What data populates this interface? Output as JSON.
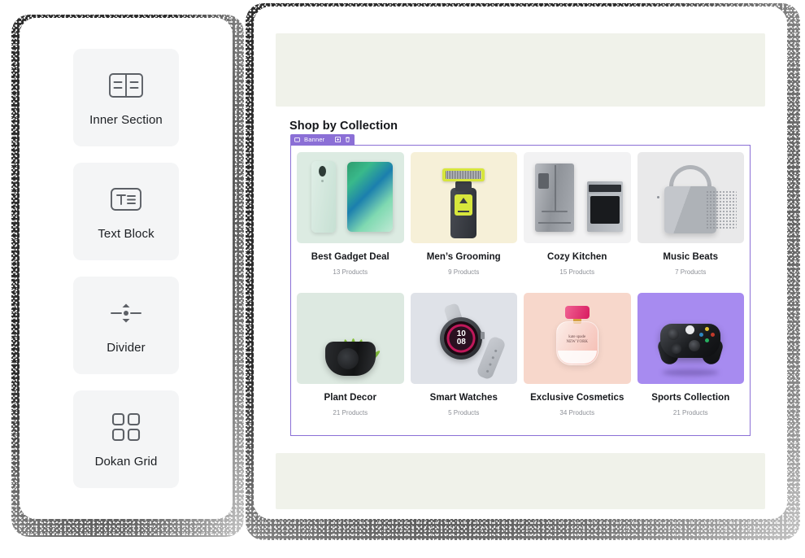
{
  "sidebar": {
    "widgets": [
      {
        "label": "Inner Section",
        "icon": "inner-section-icon"
      },
      {
        "label": "Text Block",
        "icon": "text-block-icon"
      },
      {
        "label": "Divider",
        "icon": "divider-icon"
      },
      {
        "label": "Dokan Grid",
        "icon": "dokan-grid-icon"
      }
    ]
  },
  "canvas": {
    "section_title": "Shop by Collection",
    "selection_badge": {
      "label": "Banner",
      "icons": [
        "banner-handle-icon",
        "duplicate-icon",
        "delete-icon"
      ],
      "color": "#8b6fd6"
    },
    "placeholder_color": "#f0f2ea",
    "collections": [
      {
        "name": "Best Gadget Deal",
        "count": "13 Products",
        "thumb_bg": "#dcebe2",
        "art": "tablet"
      },
      {
        "name": "Men’s Grooming",
        "count": "9 Products",
        "thumb_bg": "#f6f0d8",
        "art": "razor"
      },
      {
        "name": "Cozy Kitchen",
        "count": "15 Products",
        "thumb_bg": "#f2f2f3",
        "art": "kitchen"
      },
      {
        "name": "Music Beats",
        "count": "7 Products",
        "thumb_bg": "#e9e9ea",
        "art": "speaker"
      },
      {
        "name": "Plant Decor",
        "count": "21 Products",
        "thumb_bg": "#dde9e1",
        "art": "plant"
      },
      {
        "name": "Smart Watches",
        "count": "5 Products",
        "thumb_bg": "#dfe2e8",
        "art": "watch"
      },
      {
        "name": "Exclusive Cosmetics",
        "count": "34 Products",
        "thumb_bg": "#f7d7cb",
        "art": "perfume"
      },
      {
        "name": "Sports Collection",
        "count": "21 Products",
        "thumb_bg": "#a78bf0",
        "art": "controller"
      }
    ],
    "watch_face": {
      "line1": "10",
      "line2": "08"
    },
    "perfume_label": {
      "line1": "kate spade",
      "line2": "NEW YORK"
    }
  }
}
